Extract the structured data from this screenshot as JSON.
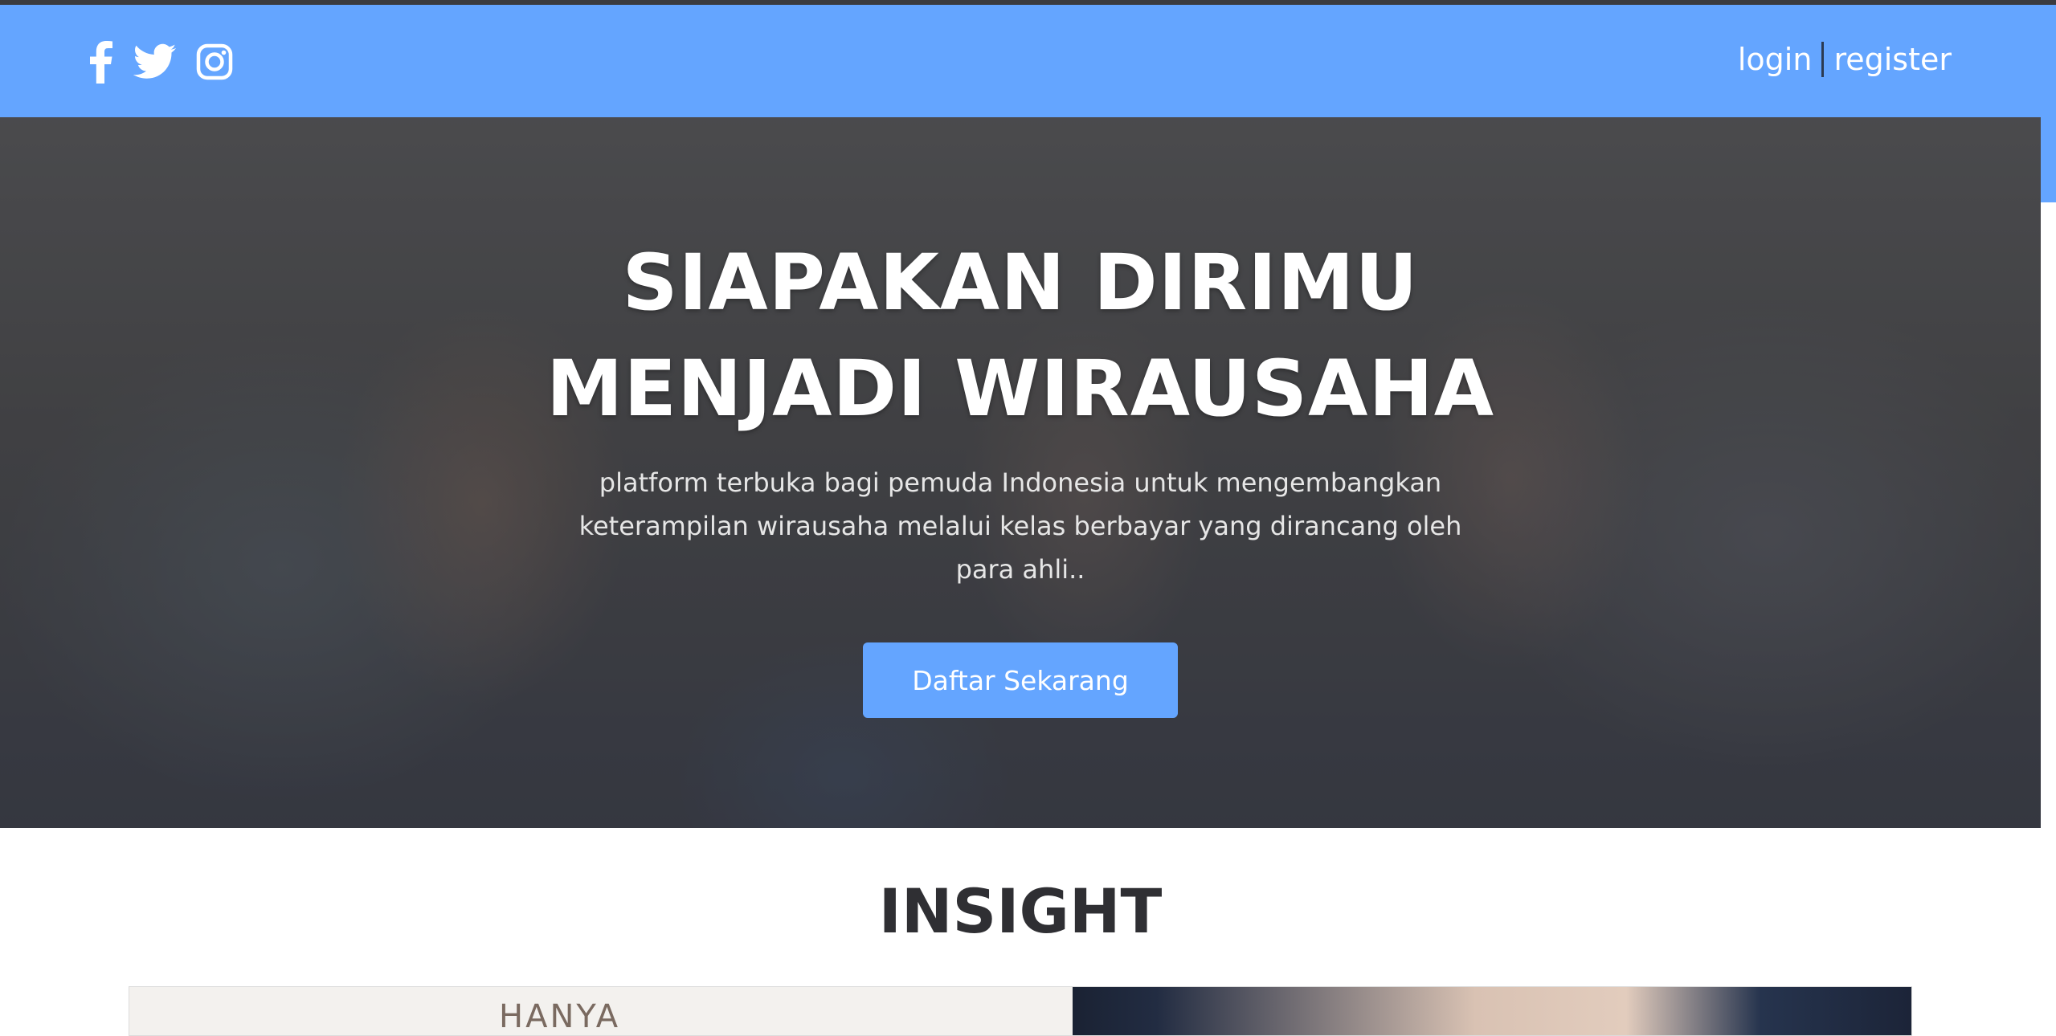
{
  "navbar": {
    "social": [
      "facebook-icon",
      "twitter-icon",
      "instagram-icon"
    ],
    "login_label": "login",
    "register_label": "register"
  },
  "hero": {
    "title_line1": "SIAPAKAN DIRIMU",
    "title_line2": "MENJADI WIRAUSAHA",
    "subtitle": "platform terbuka bagi pemuda Indonesia untuk mengembangkan keterampilan wirausaha melalui kelas berbayar yang dirancang oleh para ahli..",
    "cta_label": "Daftar Sekarang"
  },
  "insight": {
    "title": "INSIGHT",
    "card_left_text": "HANYA"
  },
  "colors": {
    "primary": "#64a5ff",
    "heading": "#2f2f33"
  }
}
